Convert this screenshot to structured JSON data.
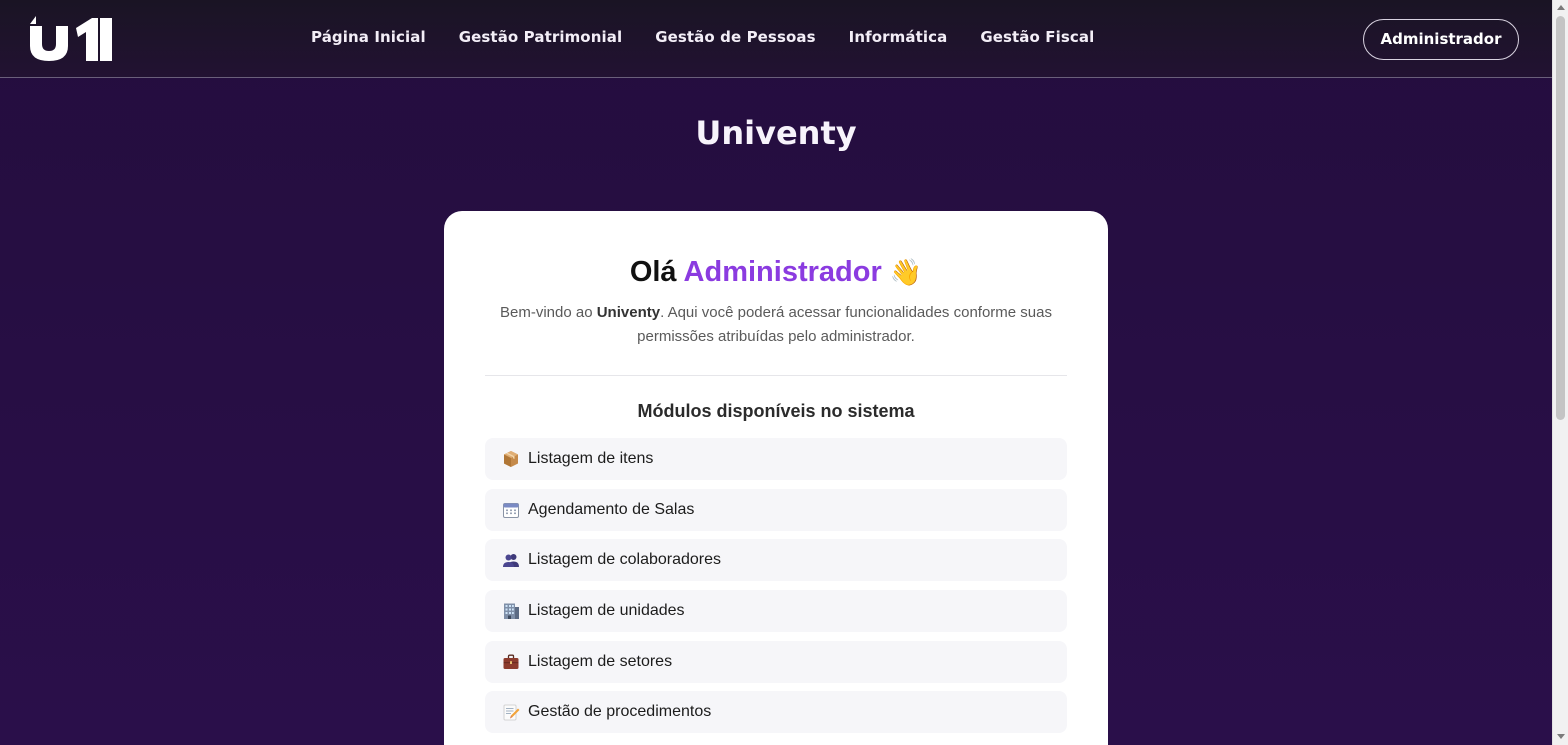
{
  "navbar": {
    "logo_text": "u1",
    "links": [
      {
        "label": "Página Inicial"
      },
      {
        "label": "Gestão Patrimonial"
      },
      {
        "label": "Gestão de Pessoas"
      },
      {
        "label": "Informática"
      },
      {
        "label": "Gestão Fiscal"
      }
    ],
    "user_button": "Administrador"
  },
  "site_title": "Univenty",
  "card": {
    "greeting_prefix": "Olá",
    "greeting_name": "Administrador",
    "greeting_emoji": "👋",
    "intro_before": "Bem-vindo ao ",
    "intro_brand": "Univenty",
    "intro_after": ". Aqui você poderá acessar funcionalidades conforme suas permissões atribuídas pelo administrador.",
    "modules_title": "Módulos disponíveis no sistema",
    "modules": [
      {
        "icon": "package-icon",
        "label": "Listagem de itens"
      },
      {
        "icon": "calendar-icon",
        "label": "Agendamento de Salas"
      },
      {
        "icon": "people-icon",
        "label": "Listagem de colaboradores"
      },
      {
        "icon": "building-icon",
        "label": "Listagem de unidades"
      },
      {
        "icon": "briefcase-icon",
        "label": "Listagem de setores"
      },
      {
        "icon": "memo-icon",
        "label": "Gestão de procedimentos"
      }
    ]
  },
  "colors": {
    "accent": "#8b3be0",
    "background": "#240d3e",
    "navbar": "#1a1424",
    "card": "#ffffff",
    "module_bg": "#f6f6f9"
  }
}
